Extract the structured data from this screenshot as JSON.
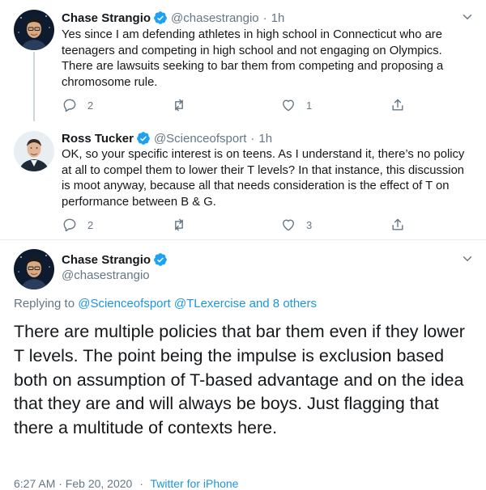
{
  "colors": {
    "accent": "#1b95e0",
    "text": "#14171a",
    "secondary": "#657786",
    "divider": "#e6ecf0"
  },
  "tweets": [
    {
      "name": "Chase Strangio",
      "verified": true,
      "handle": "@chasestrangio",
      "separator": "·",
      "time": "1h",
      "text": "Yes since I am defending athletes in high school in Connecticut who are teenagers and competing in high school and not engaging on Olympics. There are lawsuits seeking to bar them from competing and proposing a chromosome rule.",
      "replies": "2",
      "retweets": "",
      "likes": "1",
      "avatar_icon": "avatar-chase"
    },
    {
      "name": "Ross Tucker",
      "verified": true,
      "handle": "@Scienceofsport",
      "separator": "·",
      "time": "1h",
      "text": "OK, so your specific interest is on teens. As I understand it, there’s no policy at all to compel them to lower their T levels? In that instance, this discussion is moot anyway, because all that needs consideration is the effect of T on performance between B & G.",
      "replies": "2",
      "retweets": "",
      "likes": "3",
      "avatar_icon": "avatar-ross"
    }
  ],
  "main_tweet": {
    "name": "Chase Strangio",
    "verified": true,
    "handle": "@chasestrangio",
    "replying_prefix": "Replying to",
    "replying_to": [
      "@Scienceofsport",
      "@TLexercise"
    ],
    "replying_others": "and 8 others",
    "text": "There are multiple policies that bar them even if they lower T levels. The point being the impulse is exclusion based both on assumption of T-based advantage and on the idea that they are and will always be boys. Just flagging that there a multitude of contexts here.",
    "time": "6:27 AM · Feb 20, 2020",
    "separator": "·",
    "source": "Twitter for iPhone"
  }
}
